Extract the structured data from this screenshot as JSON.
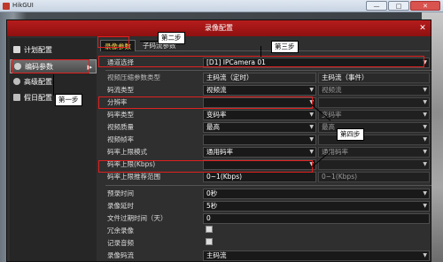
{
  "os": {
    "title": "HikGUI",
    "min": "—",
    "max": "□",
    "close": "✕"
  },
  "dialog": {
    "title": "录像配置",
    "close": "✕"
  },
  "sidebar": {
    "items": [
      {
        "label": "计划配置",
        "icon": "calendar-icon",
        "color": "#d8d8d8"
      },
      {
        "label": "编码参数",
        "icon": "gear-icon",
        "color": "#cfcfcf",
        "arrow": "▶"
      },
      {
        "label": "高级配置",
        "icon": "gear-icon",
        "color": "#bdbdbd"
      },
      {
        "label": "假日配置",
        "icon": "holiday-icon",
        "color": "#bdbdbd"
      }
    ]
  },
  "tabs": [
    {
      "label": "录像参数"
    },
    {
      "label": "子码流参数"
    }
  ],
  "channel": {
    "label": "通道选择",
    "value": "[D1] IPCamera 01"
  },
  "header": {
    "label": "视频压缩参数类型",
    "main": "主码流（定时）",
    "event": "主码流（事件）"
  },
  "rows": [
    {
      "label": "码流类型",
      "main": "视频流",
      "event": "视频流"
    },
    {
      "label": "分辨率",
      "main": "",
      "event": ""
    },
    {
      "label": "码率类型",
      "main": "变码率",
      "event": "变码率"
    },
    {
      "label": "视频质量",
      "main": "最高",
      "event": "最高"
    },
    {
      "label": "视频帧率",
      "main": "",
      "event": ""
    },
    {
      "label": "码率上限模式",
      "main": "通用码率",
      "event": "通用码率"
    },
    {
      "label": "码率上限(Kbps)",
      "main": "",
      "event": ""
    },
    {
      "label": "码率上限推荐范围",
      "main": "0~1(Kbps)",
      "event": "0~1(Kbps)"
    }
  ],
  "lower": [
    {
      "label": "预录时间",
      "value": "0秒"
    },
    {
      "label": "录像延时",
      "value": "5秒"
    },
    {
      "label": "文件过期时间（天）",
      "value": "0"
    },
    {
      "label": "冗余录像",
      "value": ""
    },
    {
      "label": "记录音频",
      "value": ""
    },
    {
      "label": "录像码流",
      "value": "主码流"
    }
  ],
  "callouts": {
    "step1": "第一步",
    "step2": "第二步",
    "step3": "第三步",
    "step4": "第四步"
  },
  "colors": {
    "accent_red": "#b61c1c",
    "highlight_yellow": "#f2d24b"
  }
}
